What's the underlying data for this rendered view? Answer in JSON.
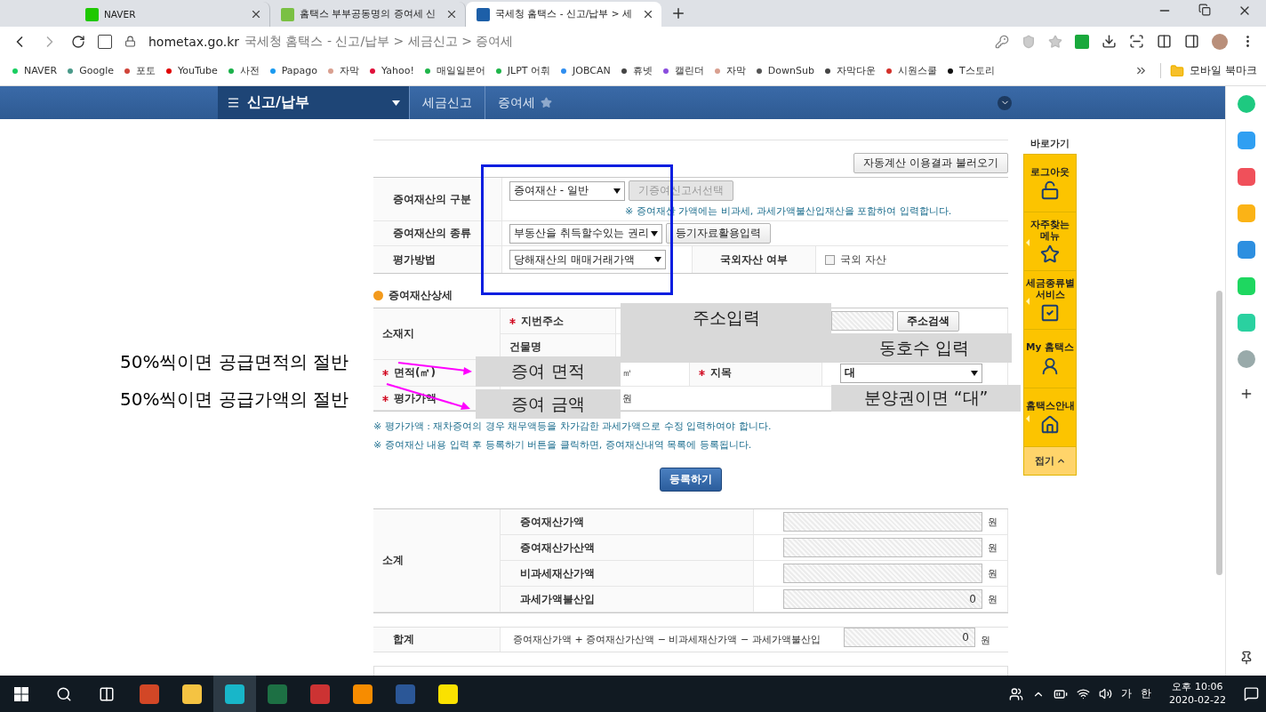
{
  "browser": {
    "tabs": [
      {
        "title": "NAVER",
        "selected": false
      },
      {
        "title": "홈택스 부부공동명의 증여세 신",
        "selected": false
      },
      {
        "title": "국세청 홈택스 - 신고/납부 > 세",
        "selected": true
      }
    ],
    "url_host": "hometax.go.kr",
    "url_path": "국세청 홈택스 - 신고/납부 > 세금신고 > 증여세",
    "bookmarks": [
      {
        "label": "NAVER",
        "color": "#19ce60"
      },
      {
        "label": "Google",
        "color": "#4a9a8a"
      },
      {
        "label": "포토",
        "color": "#d0443a"
      },
      {
        "label": "YouTube",
        "color": "#e00000"
      },
      {
        "label": "사전",
        "color": "#1bb14a"
      },
      {
        "label": "Papago",
        "color": "#1a9af0"
      },
      {
        "label": "자막",
        "color": "#d9a090"
      },
      {
        "label": "Yahoo!",
        "color": "#e0103a"
      },
      {
        "label": "매일일본어",
        "color": "#1fb54a"
      },
      {
        "label": "JLPT 어휘",
        "color": "#1fb54a"
      },
      {
        "label": "JOBCAN",
        "color": "#2f8ef0"
      },
      {
        "label": "휴넷",
        "color": "#444444"
      },
      {
        "label": "캘린더",
        "color": "#8a4ddd"
      },
      {
        "label": "자막",
        "color": "#d9a090"
      },
      {
        "label": "DownSub",
        "color": "#555555"
      },
      {
        "label": "자막다운",
        "color": "#444444"
      },
      {
        "label": "시원스쿨",
        "color": "#d3302a"
      },
      {
        "label": "T스토리",
        "color": "#111111"
      }
    ],
    "bookmarks_folder": "모바일 북마크"
  },
  "nav": {
    "menu": "신고/납부",
    "crumbs": [
      "세금신고",
      "증여세"
    ]
  },
  "form": {
    "load_button": "자동계산 이용결과 불러오기",
    "asset_class": {
      "label": "증여재산의 구분",
      "select": "증여재산 - 일반",
      "button": "기증여신고서선택",
      "button_disabled": true,
      "note": "※ 증여재산 가액에는 비과세, 과세가액불산입재산을 포함하여 입력합니다."
    },
    "asset_type": {
      "label": "증여재산의 종류",
      "select": "부동산을 취득할수있는 권리",
      "button": "등기자료활용입력",
      "button_disabled": false
    },
    "valuation": {
      "label": "평가방법",
      "select": "당해재산의 매매거래가액",
      "foreign_label": "국외자산 여부",
      "foreign_checkbox": "국외 자산",
      "checked": false
    },
    "detail": {
      "title": "증여재산상세",
      "location": "소재지",
      "address": {
        "label": "지번주소",
        "required": true,
        "button": "주소검색"
      },
      "building": {
        "label": "건물명"
      },
      "area": {
        "label": "면적(㎡)",
        "required": true,
        "unit": "㎡"
      },
      "land": {
        "label": "지목",
        "required": true,
        "value": "대"
      },
      "price": {
        "label": "평가가액",
        "required": true,
        "unit": "원"
      }
    },
    "notes": [
      "※ 평가가액 : 재차증여의 경우 채무액등을 차가감한 과세가액으로 수정 입력하여야 합니다.",
      "※ 증여재산 내용 입력 후 등록하기 버튼을 클릭하면, 증여재산내역 목록에 등록됩니다."
    ],
    "register_button": "등록하기",
    "subtotal": {
      "label": "소계",
      "rows": [
        {
          "label": "증여재산가액",
          "unit": "원"
        },
        {
          "label": "증여재산가산액",
          "unit": "원"
        },
        {
          "label": "비과세재산가액",
          "unit": "원"
        },
        {
          "label": "과세가액불산입",
          "value": "0",
          "unit": "원"
        }
      ]
    },
    "total": {
      "label": "합계",
      "formula": "증여재산가액 + 증여재산가산액 − 비과세재산가액 − 과세가액불산입",
      "value": "0",
      "unit": "원"
    }
  },
  "quick_menu": {
    "title": "바로가기",
    "items": [
      {
        "label": "로그아웃",
        "submenu": false
      },
      {
        "label": "자주찾는 메뉴",
        "submenu": true
      },
      {
        "label": "세금종류별 서비스",
        "submenu": true
      },
      {
        "label": "My 홈택스",
        "submenu": false
      },
      {
        "label": "홈택스안내",
        "submenu": true
      }
    ],
    "collapse": "접기"
  },
  "annotations": {
    "notes": [
      "50%씩이면 공급면적의 절반",
      "50%씩이면 공급가액의 절반"
    ],
    "labels": [
      "주소입력",
      "동호수 입력",
      "증여 면적",
      "증여 금액",
      "분양권이면 “대”"
    ]
  },
  "taskbar": {
    "ime": "가",
    "lang": "한",
    "time": "오후 10:06",
    "date": "2020-02-22"
  }
}
